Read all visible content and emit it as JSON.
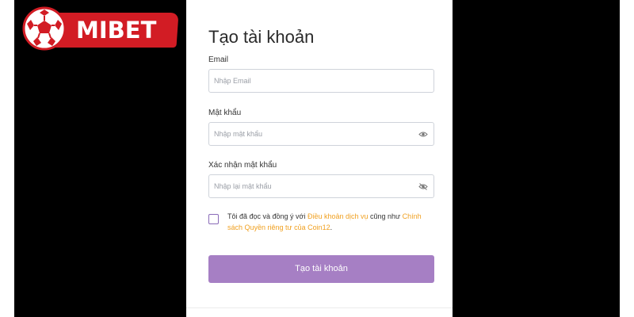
{
  "brand": {
    "name": "MIBET",
    "accent_color": "#d21c24",
    "logo_icon": "soccer-ball-icon"
  },
  "form": {
    "title": "Tạo tài khoản",
    "email": {
      "label": "Email",
      "placeholder": "Nhập Email",
      "value": ""
    },
    "password": {
      "label": "Mật khẩu",
      "placeholder": "Nhập mật khẩu",
      "value": "",
      "toggle_icon": "eye-icon"
    },
    "confirm_password": {
      "label": "Xác nhận mật khẩu",
      "placeholder": "Nhập lại mật khẩu",
      "value": "",
      "toggle_icon": "eye-icon"
    },
    "agreement": {
      "checked": false,
      "text_before": "Tôi đã đọc và đồng ý với ",
      "terms_link": "Điều khoản dịch vụ",
      "text_middle": " cũng như ",
      "privacy_link": "Chính sách Quyền riêng tư của Coin12",
      "text_after": ".",
      "link_color": "#f0a020"
    },
    "submit_label": "Tạo tài khoản",
    "submit_color": "#a67fc4"
  }
}
